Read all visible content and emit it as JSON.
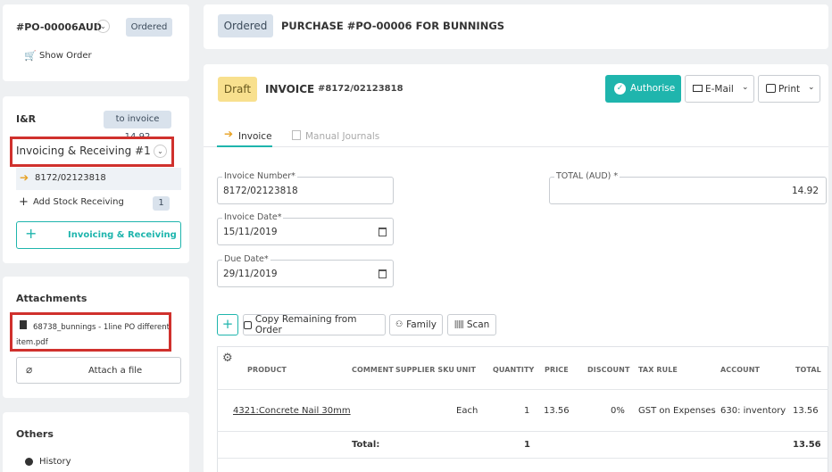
{
  "order_card": {
    "po_number": "#PO-00006AUD",
    "status_badge": "Ordered",
    "show_order": "Show Order"
  },
  "ir_card": {
    "title": "I&R",
    "badge": "to invoice 14.92",
    "dropdown_value": "Invoicing & Receiving #1",
    "invoice_link": "8172/02123818",
    "add_stock_label": "Add Stock Receiving",
    "add_stock_count": "1",
    "add_button_label": "Invoicing & Receiving"
  },
  "attachments_card": {
    "title": "Attachments",
    "file_line1": "68738_bunnings - 1line PO different",
    "file_line2": "item.pdf",
    "attach_button": "Attach a file"
  },
  "others_card": {
    "title": "Others",
    "history": "History"
  },
  "header": {
    "status": "Ordered",
    "title": "PURCHASE #PO-00006 FOR BUNNINGS"
  },
  "invoice": {
    "status": "Draft",
    "title": "INVOICE",
    "number": "#8172/02123818",
    "authorise": "Authorise",
    "email": "E-Mail",
    "print": "Print",
    "tabs": {
      "invoice": "Invoice",
      "journals": "Manual Journals"
    },
    "fields": {
      "invoice_number_label": "Invoice Number*",
      "invoice_number": "8172/02123818",
      "total_label": "TOTAL (AUD) *",
      "total": "14.92",
      "invoice_date_label": "Invoice Date*",
      "invoice_date": "15/11/2019",
      "due_date_label": "Due Date*",
      "due_date": "29/11/2019"
    },
    "toolbar": {
      "add": "+",
      "copy": "Copy Remaining from Order",
      "family": "Family",
      "scan": "Scan"
    },
    "table": {
      "headers": [
        "PRODUCT",
        "COMMENT",
        "SUPPLIER SKU",
        "UNIT",
        "QUANTITY",
        "PRICE",
        "DISCOUNT",
        "TAX RULE",
        "ACCOUNT",
        "TOTAL"
      ],
      "row": {
        "product": "4321:Concrete Nail 30mm",
        "unit": "Each",
        "quantity": "1",
        "price": "13.56",
        "discount": "0%",
        "tax_rule": "GST on Expenses",
        "account": "630: inventory",
        "total": "13.56"
      },
      "totals": {
        "label": "Total:",
        "quantity": "1",
        "total": "13.56"
      }
    }
  },
  "colors": {
    "accent": "#1fb5ad",
    "draft": "#f8e08e",
    "highlight": "#d0312d"
  }
}
